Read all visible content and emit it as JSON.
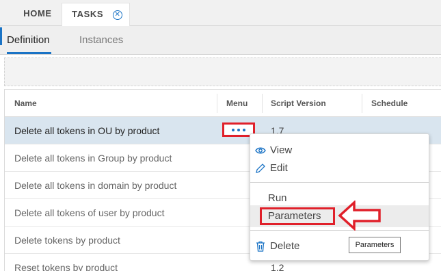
{
  "tabs": {
    "home": "HOME",
    "tasks": "TASKS",
    "close_glyph": "✕"
  },
  "subtabs": {
    "definition": "Definition",
    "instances": "Instances"
  },
  "columns": {
    "name": "Name",
    "menu": "Menu",
    "script_version": "Script Version",
    "schedule": "Schedule"
  },
  "rows": [
    {
      "name": "Delete all tokens in OU by product",
      "version": "1.7"
    },
    {
      "name": "Delete all tokens in Group by product",
      "version": ""
    },
    {
      "name": "Delete all tokens in domain by product",
      "version": ""
    },
    {
      "name": "Delete all tokens of user by product",
      "version": ""
    },
    {
      "name": "Delete tokens by product",
      "version": ""
    },
    {
      "name": "Reset tokens by product",
      "version": "1.2"
    }
  ],
  "context_menu": {
    "view": "View",
    "edit": "Edit",
    "run": "Run",
    "parameters": "Parameters",
    "delete": "Delete"
  },
  "tooltip": "Parameters",
  "colors": {
    "accent": "#1a73c5",
    "highlight": "#e0202a",
    "selected_row": "#d9e5ef"
  }
}
